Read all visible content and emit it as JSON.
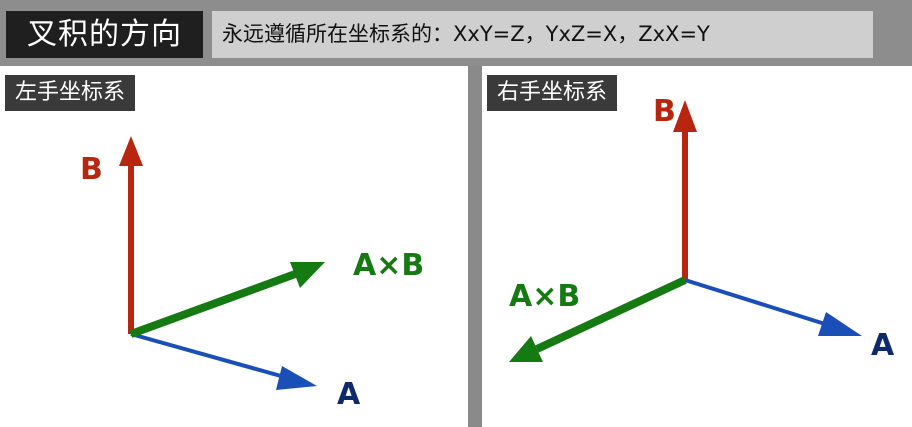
{
  "header": {
    "title": "叉积的方向",
    "subtitle": "永远遵循所在坐标系的：XxY=Z，YxZ=X，ZxX=Y"
  },
  "left_panel": {
    "label": "左手坐标系",
    "vectors": {
      "a_label": "A",
      "b_label": "B",
      "axb_label": "A×B"
    }
  },
  "right_panel": {
    "label": "右手坐标系",
    "vectors": {
      "a_label": "A",
      "b_label": "B",
      "axb_label": "A×B"
    }
  },
  "colors": {
    "vector_a": "#1a4fb8",
    "vector_b": "#b8260f",
    "vector_axb": "#157a12",
    "label_a": "#0f2a6b",
    "label_b": "#b8260f",
    "label_axb": "#157a12"
  }
}
